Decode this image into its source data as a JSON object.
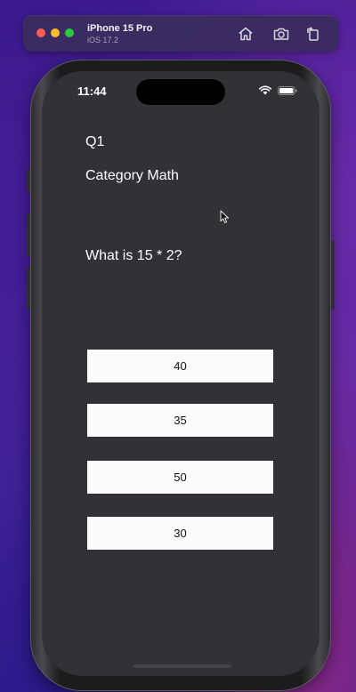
{
  "simulator": {
    "device_name": "iPhone 15 Pro",
    "os_version": "iOS 17.2",
    "traffic_lights": {
      "close": "#ff5f57",
      "minimize": "#febc2e",
      "zoom": "#28c840"
    },
    "toolbar_icons": [
      "home-icon",
      "screenshot-icon",
      "rotate-icon"
    ]
  },
  "status_bar": {
    "time": "11:44",
    "icons": [
      "wifi-icon",
      "battery-icon"
    ]
  },
  "quiz": {
    "question_number": "Q1",
    "category": "Category Math",
    "question": "What is 15 * 2?",
    "answers": [
      "40",
      "35",
      "50",
      "30"
    ]
  },
  "colors": {
    "screen_background": "#313236",
    "answer_button_background": "#fdfbfc",
    "answer_button_text": "#111111",
    "text_primary": "#ffffff"
  }
}
